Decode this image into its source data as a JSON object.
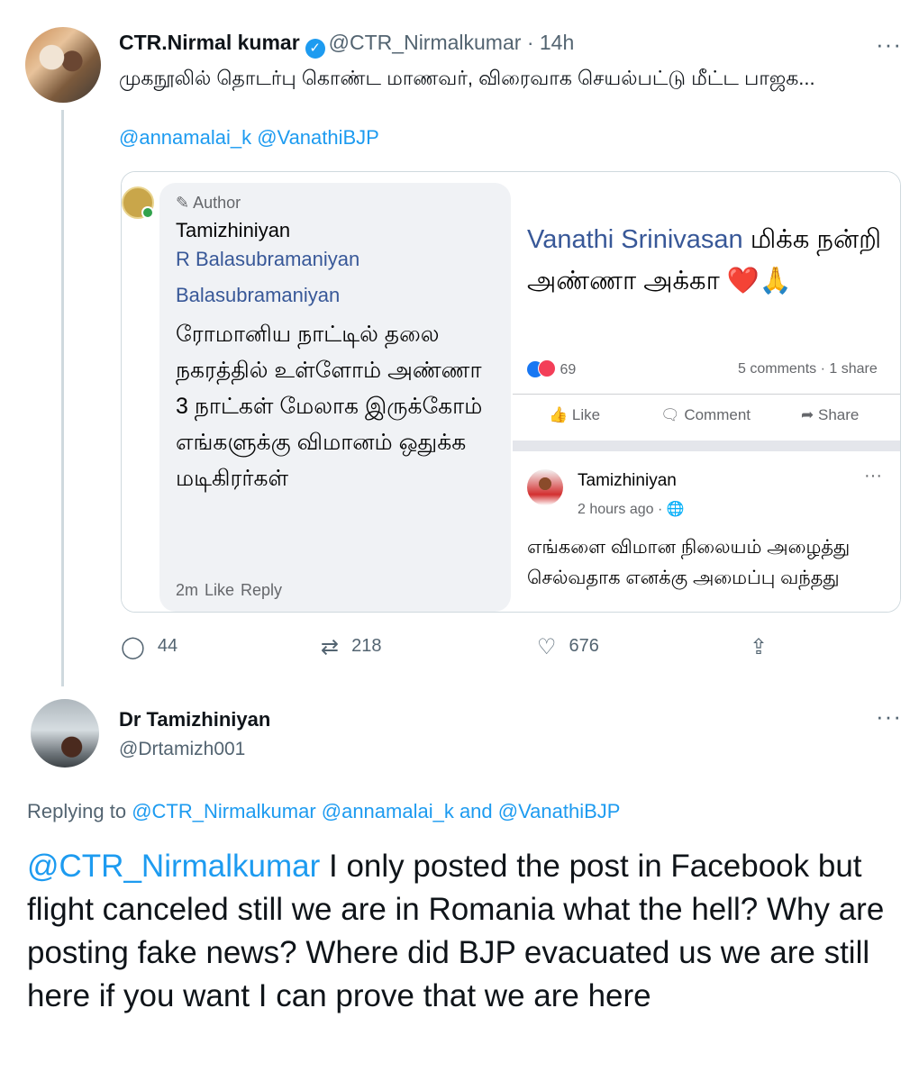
{
  "tweet": {
    "author_name": "CTR.Nirmal kumar",
    "verified_icon": "verified-badge-icon",
    "handle": "@CTR_Nirmalkumar",
    "time": "· 14h",
    "more": "···",
    "text": "முகநூலில் தொடர்பு கொண்ட மாணவர், விரைவாக செயல்பட்டு மீட்ட பாஜக...",
    "mentions": "@annamalai_k @VanathiBJP",
    "stats": {
      "replies": "44",
      "retweets": "218",
      "likes": "676"
    }
  },
  "embedded_card": {
    "left": {
      "author_tag": "✎ Author",
      "name": "Tamizhiniyan",
      "name2": "R Balasubramaniyan",
      "name3": "Balasubramaniyan",
      "body": "ரோமானிய நாட்டில் தலை நகரத்தில் உள்ளோம் அண்ணா 3 நாட்கள் மேலாக இருக்கோம் எங்களுக்கு விமானம் ஒதுக்க மடிகிரர்கள்",
      "actions": "2m   Like   Reply"
    },
    "right": {
      "commenter": "Vanathi Srinivasan",
      "comment": " மிக்க நன்றி அண்ணா அக்கா ❤️🙏",
      "reaction_count": "69",
      "comments_shares": "5 comments · 1 share",
      "buttons": [
        "Like",
        "Comment",
        "Share"
      ],
      "post_author": "Tamizhiniyan",
      "post_time": "2 hours ago · 🌐",
      "post_more": "···",
      "post_body": "எங்களை விமான நிலையம் அழைத்து செல்வதாக எனக்கு அமைப்பு வந்தது"
    }
  },
  "reply": {
    "author_name": "Dr Tamizhiniyan",
    "handle": "@Drtamizh001",
    "more": "···",
    "replying_prefix": "Replying to ",
    "replying_to": "@CTR_Nirmalkumar @annamalai_k and @VanathiBJP",
    "mention": "@CTR_Nirmalkumar",
    "text": " I only posted the post in Facebook but flight canceled still we are in Romania what the hell? Why are posting fake news? Where did BJP evacuated us we are still here if you want I can prove that we are here"
  },
  "colors": {
    "link_blue": "#1d9bf0",
    "text_dark": "#0f1419",
    "text_grey": "#536471",
    "fb_link": "#385898"
  }
}
